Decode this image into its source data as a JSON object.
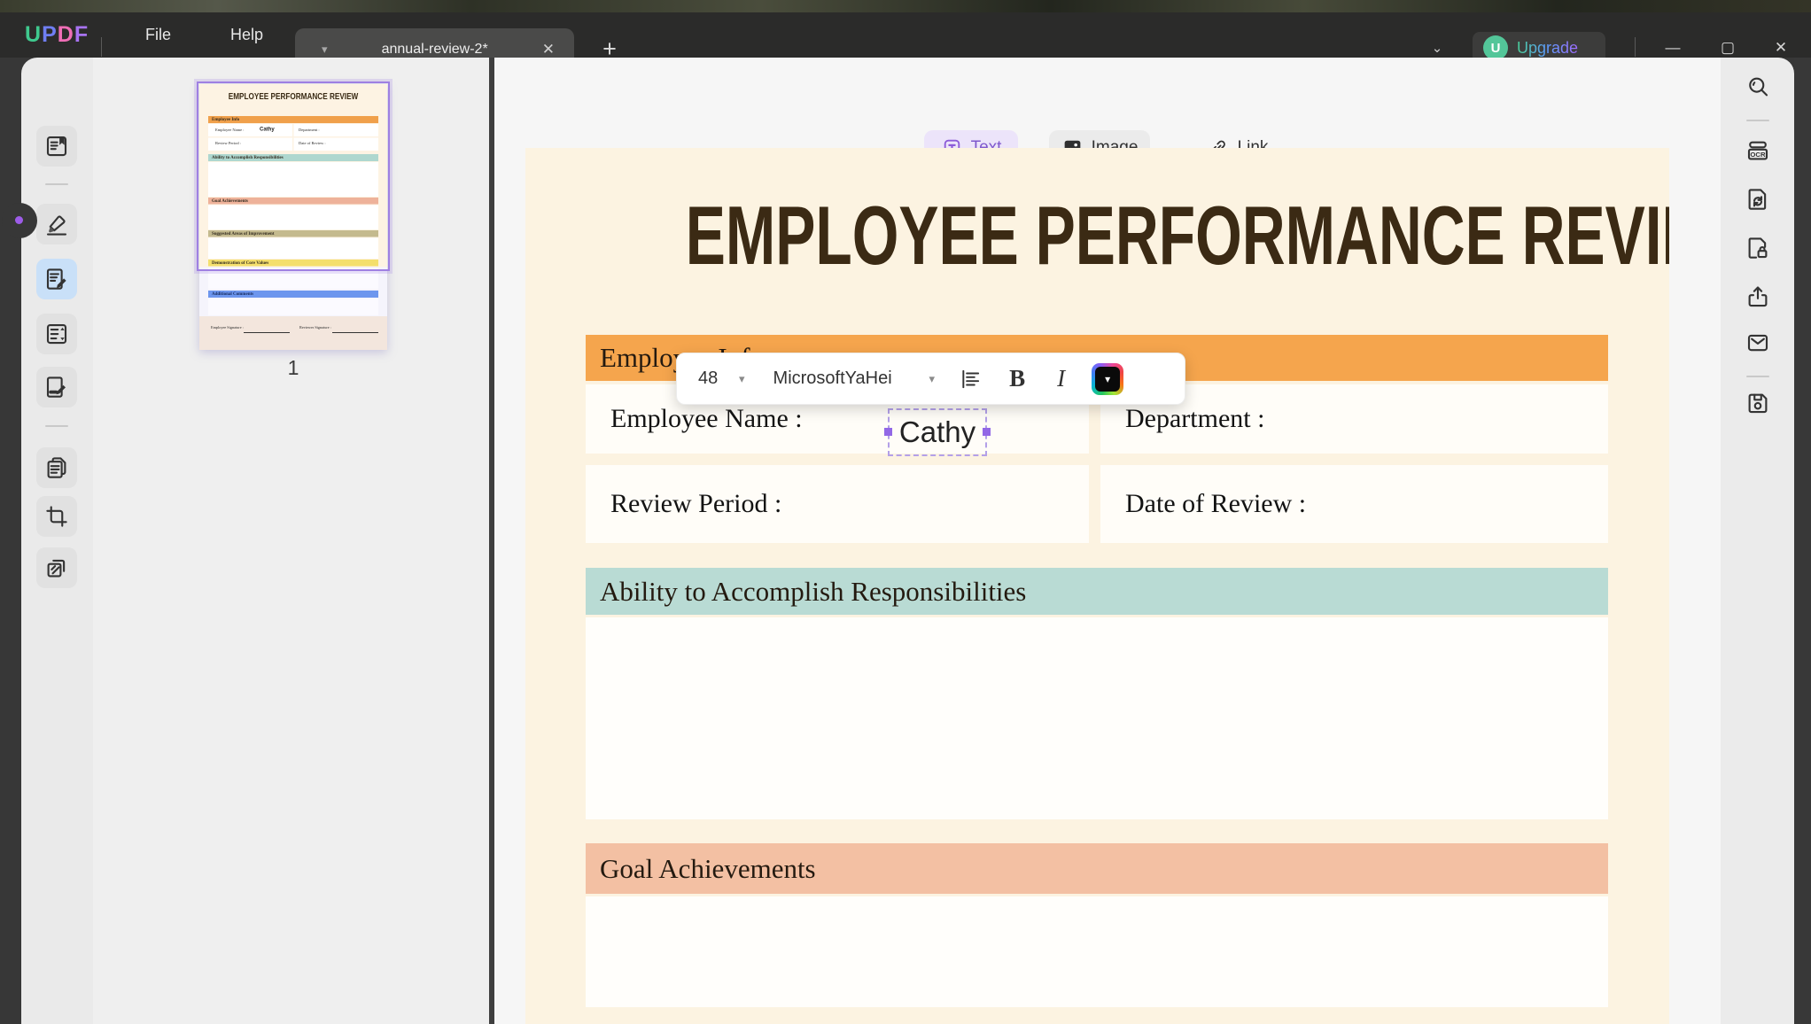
{
  "titlebar": {
    "logo_letters": [
      {
        "char": "U",
        "color": "#3fc98e"
      },
      {
        "char": "P",
        "color": "#6f7ef2"
      },
      {
        "char": "D",
        "color": "#ef6eb6"
      },
      {
        "char": "F",
        "color": "#a873f2"
      }
    ],
    "menu_file": "File",
    "menu_help": "Help",
    "tab_label": "annual-review-2*",
    "avatar_initial": "U",
    "upgrade_label": "Upgrade"
  },
  "left_toolbar": {
    "tools": [
      {
        "name": "reader-mode"
      },
      {
        "name": "highlighter"
      },
      {
        "name": "edit",
        "active": true
      },
      {
        "name": "organize-pages"
      },
      {
        "name": "fill-sign"
      },
      {
        "name": "convert"
      },
      {
        "name": "crop"
      },
      {
        "name": "watermark"
      }
    ]
  },
  "right_toolbar": {
    "tools": [
      {
        "name": "search"
      },
      {
        "name": "ocr"
      },
      {
        "name": "compress"
      },
      {
        "name": "protect"
      },
      {
        "name": "share"
      },
      {
        "name": "mail"
      },
      {
        "name": "save"
      }
    ],
    "ocr_label": "OCR"
  },
  "thumb_panel": {
    "page_number": "1"
  },
  "thumbnail_page": {
    "title": "EMPLOYEE PERFORMANCE REVIEW",
    "info_header": "Employee Info",
    "employee_name_label": "Employee Name :",
    "employee_name_value": "Cathy",
    "department_label": "Department :",
    "review_period_label": "Review Period :",
    "date_of_review_label": "Date of Review :",
    "ability_header": "Ability to Accomplish Responsibilities",
    "goals_header": "Goal Achievements",
    "suggestions_header": "Suggested Areas of Improvement",
    "core_values_header": "Demonstration of Core Values",
    "comments_header": "Additional Comments",
    "employee_signature_label": "Employee Signature :",
    "reviewer_signature_label": "Reviewer Signature :"
  },
  "edit_toolbar": {
    "text_label": "Text",
    "image_label": "Image",
    "link_label": "Link"
  },
  "format_toolbar": {
    "font_size": "48",
    "font_name": "MicrosoftYaHei",
    "bold_label": "B",
    "italic_label": "I"
  },
  "document": {
    "title": "EMPLOYEE PERFORMANCE REVIEW",
    "info_header": "Employee Info",
    "employee_name_label": "Employee Name :",
    "employee_name_value": "Cathy",
    "department_label": "Department :",
    "review_period_label": "Review Period :",
    "date_of_review_label": "Date of Review :",
    "ability_header": "Ability to Accomplish Responsibilities",
    "goals_header": "Goal Achievements"
  },
  "colors": {
    "accent_purple": "#7e57cc",
    "selection_purple": "#9f80e2",
    "header_orange": "#f5a54d",
    "header_teal": "#b9dbd4",
    "header_salmon": "#f3c0a3",
    "header_olive": "#c4ba8e",
    "header_yellow": "#f4df6d",
    "header_blue": "#6d96ee",
    "page_cream": "#fcf3e1",
    "titlebar_dark": "#2b2b2a",
    "active_tool_blue": "#c9e0f8"
  }
}
